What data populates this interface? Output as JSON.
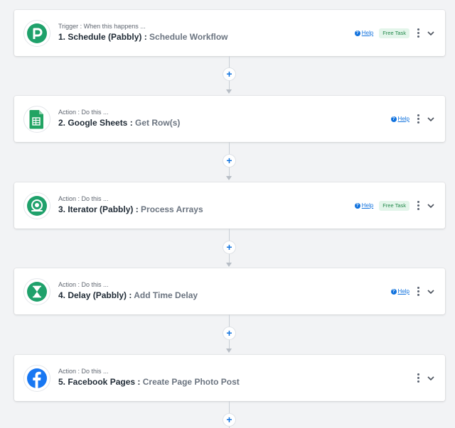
{
  "steps": [
    {
      "label": "Trigger : When this happens ...",
      "title": "1. Schedule (Pabbly) :",
      "action": "Schedule Workflow",
      "help": "Help",
      "badge": "Free Task",
      "icon": "pabbly-schedule-icon"
    },
    {
      "label": "Action : Do this ...",
      "title": "2. Google Sheets :",
      "action": "Get Row(s)",
      "help": "Help",
      "badge": "",
      "icon": "google-sheets-icon"
    },
    {
      "label": "Action : Do this ...",
      "title": "3. Iterator (Pabbly) :",
      "action": "Process Arrays",
      "help": "Help",
      "badge": "Free Task",
      "icon": "iterator-icon"
    },
    {
      "label": "Action : Do this ...",
      "title": "4. Delay (Pabbly) :",
      "action": "Add Time Delay",
      "help": "Help",
      "badge": "",
      "icon": "hourglass-icon"
    },
    {
      "label": "Action : Do this ...",
      "title": "5. Facebook Pages :",
      "action": "Create Page Photo Post",
      "help": "",
      "badge": "",
      "icon": "facebook-icon"
    }
  ],
  "plus_label": "+",
  "help_glyph": "?",
  "colors": {
    "accent": "#1273de",
    "pabbly_green": "#1fa16b",
    "sheets_green": "#22a463",
    "facebook_blue": "#1877f2"
  }
}
